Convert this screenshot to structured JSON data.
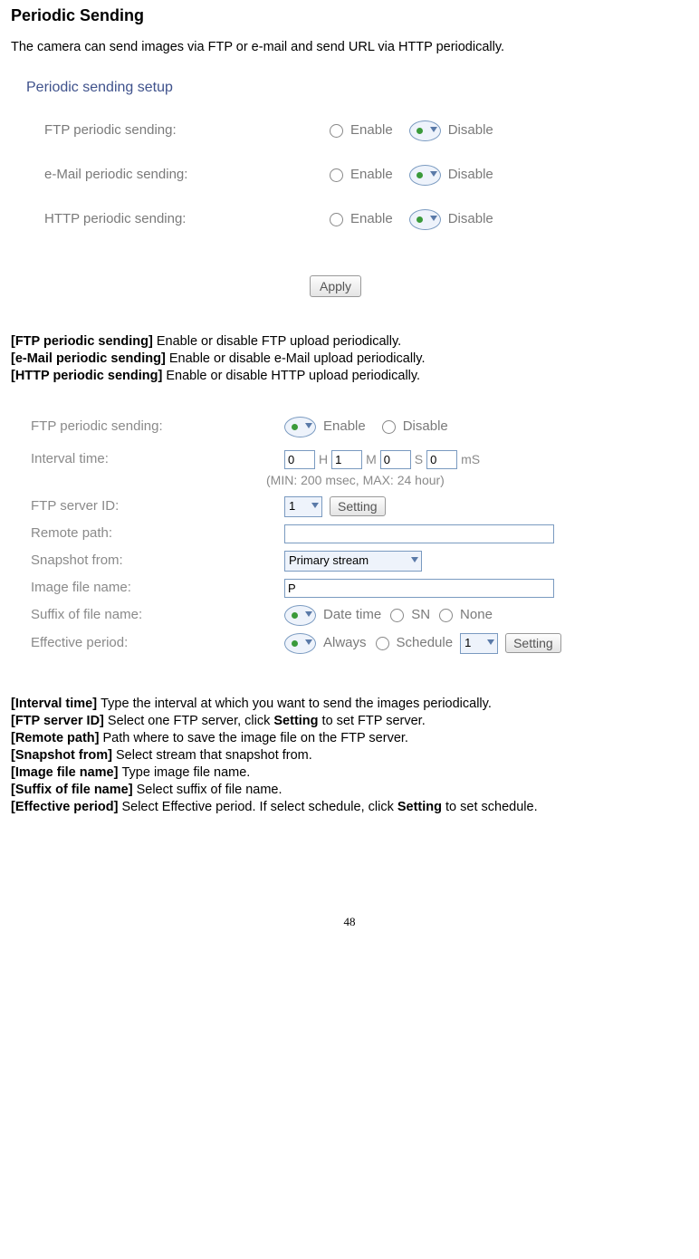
{
  "title": "Periodic Sending",
  "intro": "The camera can send images via FTP or e-mail and send URL via HTTP periodically.",
  "panel1": {
    "heading": "Periodic sending setup",
    "rows": [
      {
        "label": "FTP periodic sending:",
        "enable": "Enable",
        "disable": "Disable"
      },
      {
        "label": "e-Mail periodic sending:",
        "enable": "Enable",
        "disable": "Disable"
      },
      {
        "label": "HTTP periodic sending:",
        "enable": "Enable",
        "disable": "Disable"
      }
    ],
    "apply": "Apply"
  },
  "desc1": {
    "l1b": "[FTP periodic sending] ",
    "l1": "Enable or disable FTP upload periodically.",
    "l2b": "[e-Mail periodic sending] ",
    "l2": "Enable or disable e-Mail upload periodically.",
    "l3b": "[HTTP periodic sending] ",
    "l3": "Enable or disable HTTP upload periodically."
  },
  "panel2": {
    "r1": {
      "label": "FTP periodic sending:",
      "enable": "Enable",
      "disable": "Disable"
    },
    "r2": {
      "label": "Interval time:",
      "h": "0",
      "m": "1",
      "s": "0",
      "ms": "0",
      "uh": "H",
      "um": "M",
      "us": "S",
      "ums": "mS"
    },
    "hint": "(MIN: 200 msec, MAX: 24 hour)",
    "r3": {
      "label": "FTP server ID:",
      "val": "1",
      "btn": "Setting"
    },
    "r4": {
      "label": "Remote path:",
      "val": ""
    },
    "r5": {
      "label": "Snapshot from:",
      "val": "Primary stream"
    },
    "r6": {
      "label": "Image file name:",
      "val": "P"
    },
    "r7": {
      "label": "Suffix of file name:",
      "o1": "Date time",
      "o2": "SN",
      "o3": "None"
    },
    "r8": {
      "label": "Effective period:",
      "o1": "Always",
      "o2": "Schedule",
      "val": "1",
      "btn": "Setting"
    }
  },
  "desc2": {
    "l1b": "[Interval time] ",
    "l1": "Type the interval at which you want to send the images periodically.",
    "l2b": "[FTP server ID] ",
    "l2a": "Select one FTP server, click ",
    "l2s": "Setting",
    "l2c": " to set FTP server.",
    "l3b": "[Remote path] ",
    "l3": "Path where to save the image file on the FTP server.",
    "l4b": "[Snapshot from] ",
    "l4": "Select stream that snapshot from.",
    "l5b": "[Image file name] ",
    "l5": "Type image file name.",
    "l6b": "[Suffix of file name] ",
    "l6": "Select suffix of file name.",
    "l7b": "[Effective period] ",
    "l7a": "Select Effective period. If select    schedule, click ",
    "l7s": "Setting",
    "l7c": " to set schedule."
  },
  "page": "48"
}
